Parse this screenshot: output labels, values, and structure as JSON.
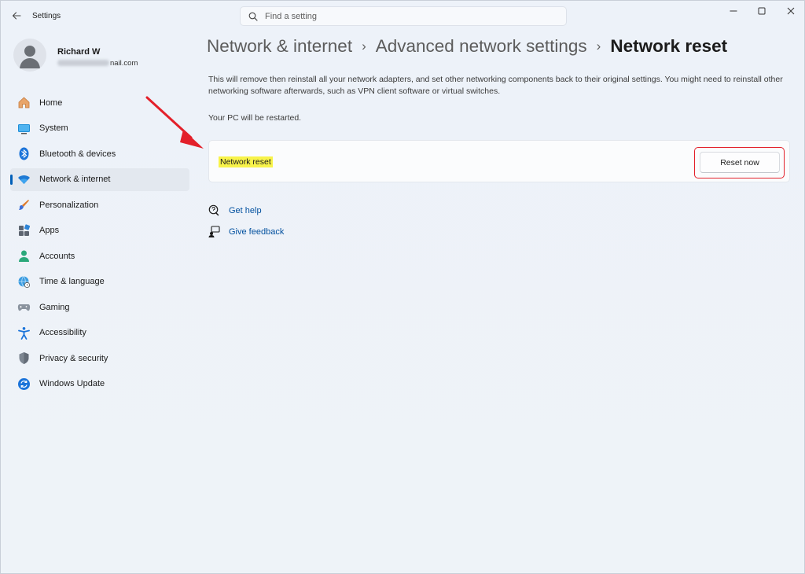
{
  "window": {
    "title": "Settings",
    "search_placeholder": "Find a setting"
  },
  "profile": {
    "name": "Richard W",
    "email_visible": "nail.com"
  },
  "sidebar": {
    "items": [
      {
        "label": "Home",
        "icon": "home-icon"
      },
      {
        "label": "System",
        "icon": "system-icon"
      },
      {
        "label": "Bluetooth & devices",
        "icon": "bluetooth-icon"
      },
      {
        "label": "Network & internet",
        "icon": "wifi-icon",
        "active": true
      },
      {
        "label": "Personalization",
        "icon": "brush-icon"
      },
      {
        "label": "Apps",
        "icon": "apps-icon"
      },
      {
        "label": "Accounts",
        "icon": "accounts-icon"
      },
      {
        "label": "Time & language",
        "icon": "globe-clock-icon"
      },
      {
        "label": "Gaming",
        "icon": "gamepad-icon"
      },
      {
        "label": "Accessibility",
        "icon": "accessibility-icon"
      },
      {
        "label": "Privacy & security",
        "icon": "shield-icon"
      },
      {
        "label": "Windows Update",
        "icon": "update-icon"
      }
    ]
  },
  "breadcrumb": {
    "items": [
      "Network & internet",
      "Advanced network settings"
    ],
    "separator": "›",
    "current": "Network reset"
  },
  "content": {
    "description": "This will remove then reinstall all your network adapters, and set other networking components back to their original settings. You might need to reinstall other networking software afterwards, such as VPN client software or virtual switches.",
    "restart_note": "Your PC will be restarted.",
    "card_label": "Network reset",
    "reset_button": "Reset now",
    "links": {
      "get_help": "Get help",
      "give_feedback": "Give feedback"
    }
  },
  "colors": {
    "accent": "#005fb8",
    "annotation_red": "#e3202a",
    "highlight_yellow": "#f8f34a",
    "link": "#004f9e"
  }
}
